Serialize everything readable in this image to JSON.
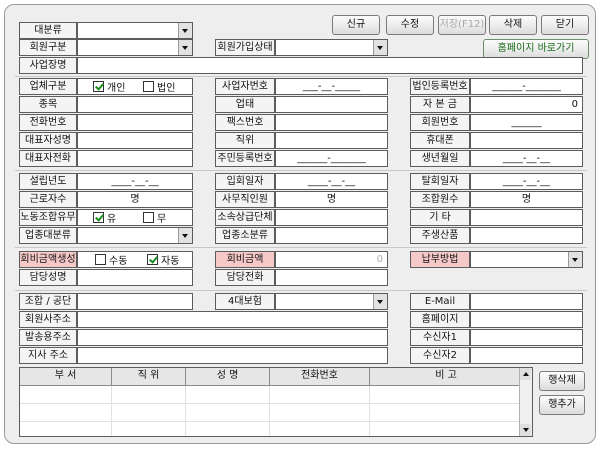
{
  "toolbar": {
    "new": "신규",
    "edit": "수정",
    "save": "저장(F12)",
    "delete": "삭제",
    "close": "닫기",
    "homepage": "홈페이지 바로가기"
  },
  "row1": {
    "category_label": "대분류"
  },
  "row2": {
    "member_type_label": "회원구분",
    "join_status_label": "회원가입상태"
  },
  "row3": {
    "business_name_label": "사업장명"
  },
  "biz": {
    "type_label": "업체구분",
    "type_personal": "개인",
    "type_corporate": "법인",
    "bizno_label": "사업자번호",
    "bizno_value": "___-__-_____",
    "corpno_label": "법인등록번호",
    "corpno_value": "______-_______",
    "item_label": "종목",
    "category_label": "업태",
    "capital_label": "자 본 금",
    "capital_value": "0",
    "phone_label": "전화번호",
    "fax_label": "팩스번호",
    "memberno_label": "회원번호",
    "memberno_value": "______",
    "ceo_label": "대표자성명",
    "position_label": "직위",
    "mobile_label": "휴대폰",
    "ceo_phone_label": "대표자전화",
    "rrn_label": "주민등록번호",
    "rrn_value": "______-_______",
    "birth_label": "생년월일",
    "birth_value": "____-__-__"
  },
  "company": {
    "founded_label": "설립년도",
    "founded_value": "____-__-__",
    "join_date_label": "입회일자",
    "join_date_value": "____-__-__",
    "leave_date_label": "탈회일자",
    "leave_date_value": "____-__-__",
    "employees_label": "근로자수",
    "employees_unit": "명",
    "office_staff_label": "사무직인원",
    "office_staff_unit": "명",
    "union_members_label": "조합원수",
    "union_members_unit": "명",
    "union_label": "노동조합유무",
    "union_yes": "유",
    "union_no": "무",
    "affiliation_label": "소속상급단체",
    "etc_label": "기 타",
    "industry_major_label": "업종대분류",
    "industry_minor_label": "업종소분류",
    "products_label": "주생산품"
  },
  "fee": {
    "generate_label": "회비금액생성",
    "manual": "수동",
    "auto": "자동",
    "amount_label": "회비금액",
    "amount_value": "0",
    "payment_label": "납부방법",
    "manager_name_label": "담당성명",
    "manager_phone_label": "담당전화"
  },
  "contact": {
    "union_label": "조합 / 공단",
    "insurance_label": "4대보험",
    "email_label": "E-Mail",
    "address_label": "회원사주소",
    "homepage_label": "홈페이지",
    "mailing_label": "발송용주소",
    "recipient1_label": "수신자1",
    "branch_label": "지사 주소",
    "recipient2_label": "수신자2"
  },
  "grid": {
    "columns": [
      "부 서",
      "직 위",
      "성 명",
      "전화번호",
      "비 고"
    ],
    "delete_row": "행삭제",
    "add_row": "행추가"
  }
}
